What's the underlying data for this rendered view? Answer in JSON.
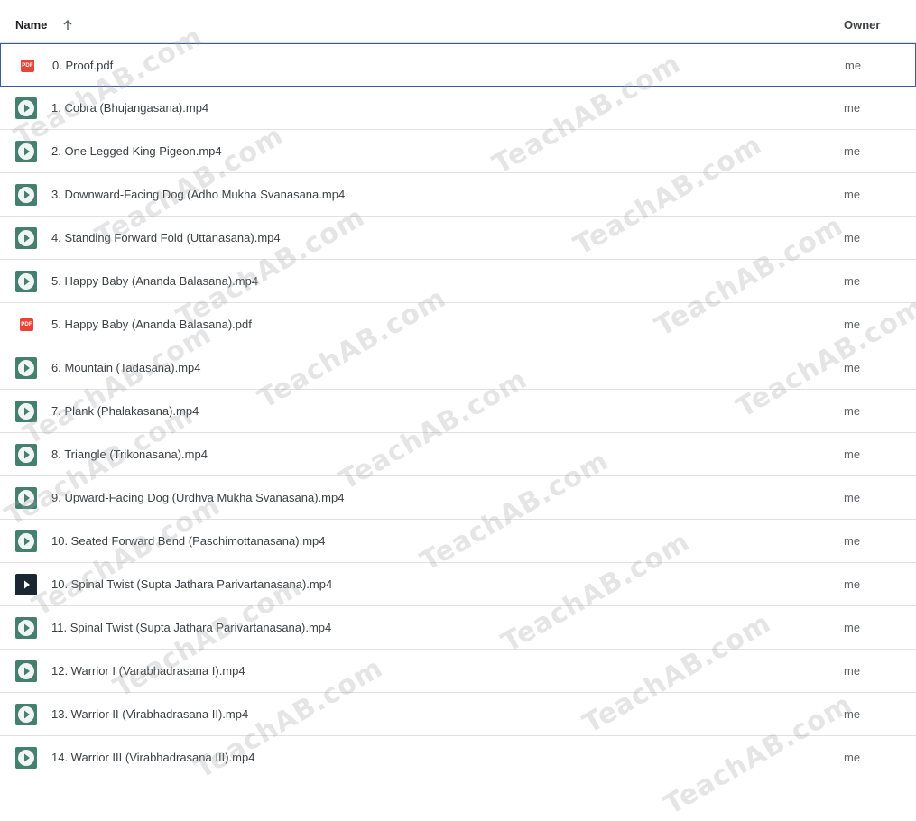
{
  "header": {
    "name_label": "Name",
    "owner_label": "Owner"
  },
  "accent_colors": {
    "video_icon": "#45806e",
    "video_icon_dark": "#1a2733",
    "pdf_icon": "#ea4335",
    "selected_border": "#3b5b9a"
  },
  "files": [
    {
      "name": "0. Proof.pdf",
      "owner": "me",
      "type": "pdf",
      "selected": true
    },
    {
      "name": "1. Cobra (Bhujangasana).mp4",
      "owner": "me",
      "type": "video"
    },
    {
      "name": "2. One Legged King Pigeon.mp4",
      "owner": "me",
      "type": "video"
    },
    {
      "name": "3. Downward-Facing Dog (Adho Mukha Svanasana.mp4",
      "owner": "me",
      "type": "video"
    },
    {
      "name": "4. Standing Forward Fold (Uttanasana).mp4",
      "owner": "me",
      "type": "video"
    },
    {
      "name": "5. Happy Baby (Ananda Balasana).mp4",
      "owner": "me",
      "type": "video"
    },
    {
      "name": "5. Happy Baby (Ananda Balasana).pdf",
      "owner": "me",
      "type": "pdf"
    },
    {
      "name": "6. Mountain (Tadasana).mp4",
      "owner": "me",
      "type": "video"
    },
    {
      "name": "7. Plank (Phalakasana).mp4",
      "owner": "me",
      "type": "video"
    },
    {
      "name": "8. Triangle (Trikonasana).mp4",
      "owner": "me",
      "type": "video"
    },
    {
      "name": "9. Upward-Facing Dog (Urdhva Mukha Svanasana).mp4",
      "owner": "me",
      "type": "video"
    },
    {
      "name": "10. Seated Forward Bend (Paschimottanasana).mp4",
      "owner": "me",
      "type": "video"
    },
    {
      "name": "10. Spinal Twist (Supta Jathara Parivartanasana).mp4",
      "owner": "me",
      "type": "video-dark"
    },
    {
      "name": "11. Spinal Twist (Supta Jathara Parivartanasana).mp4",
      "owner": "me",
      "type": "video"
    },
    {
      "name": "12. Warrior I (Varabhadrasana I).mp4",
      "owner": "me",
      "type": "video"
    },
    {
      "name": "13. Warrior II (Virabhadrasana II).mp4",
      "owner": "me",
      "type": "video"
    },
    {
      "name": "14. Warrior III (Virabhadrasana III).mp4",
      "owner": "me",
      "type": "video"
    }
  ],
  "watermark_text": "TeachAB.com",
  "pdf_badge_text": "PDF"
}
